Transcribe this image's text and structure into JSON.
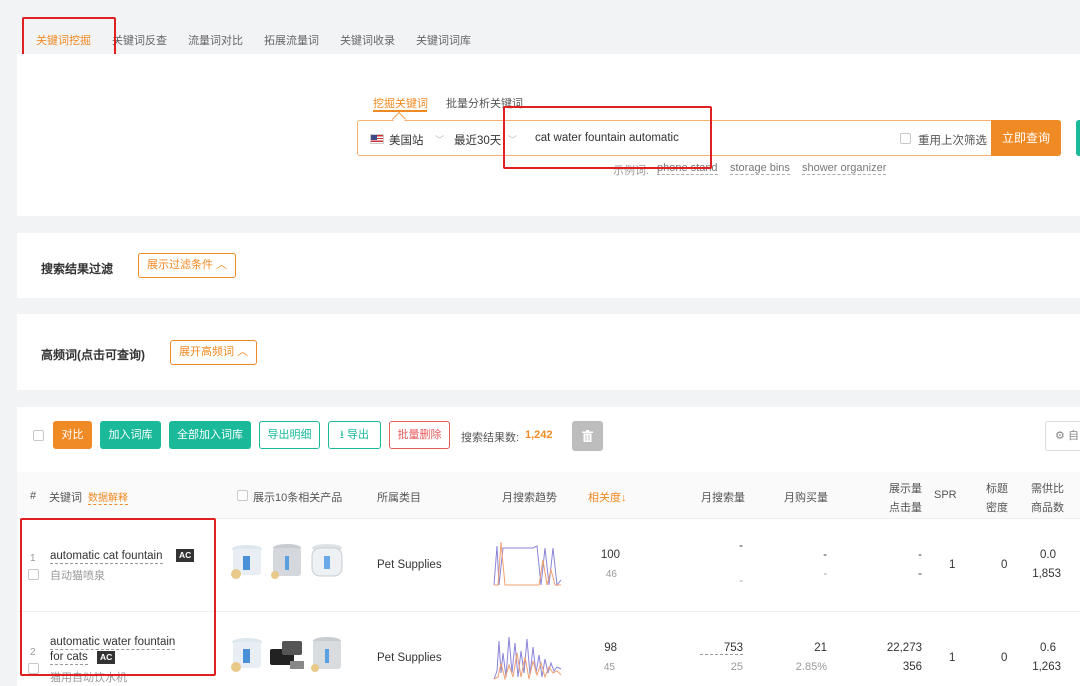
{
  "top_tabs": [
    "关键词挖掘",
    "关键词反查",
    "流量词对比",
    "拓展流量词",
    "关键词收录",
    "关键词词库"
  ],
  "search": {
    "subtabs": [
      "挖掘关键词",
      "批量分析关键词"
    ],
    "site": "美国站",
    "period": "最近30天",
    "query": "cat water fountain automatic",
    "reuse_label": "重用上次筛选",
    "submit_label": "立即查询",
    "examples_label": "示例词:",
    "examples": [
      "phone stand",
      "storage bins",
      "shower organizer"
    ]
  },
  "filter": {
    "title": "搜索结果过滤",
    "toggle": "展示过滤条件"
  },
  "frequent": {
    "title": "高频词(点击可查询)",
    "toggle": "展开高频词"
  },
  "toolbar": {
    "compare": "对比",
    "add_lib": "加入词库",
    "add_all": "全部加入词库",
    "export_detail": "导出明细",
    "export": "导出",
    "batch_delete": "批量删除",
    "count_label": "搜索结果数:",
    "count": "1,242",
    "settings_partial": "自"
  },
  "table": {
    "headers": {
      "index": "#",
      "keyword": "关键词",
      "data_explain": "数据解释",
      "show_products": "展示10条相关产品",
      "category": "所属类目",
      "trend": "月搜索趋势",
      "relevance": "相关度",
      "monthly_search": "月搜索量",
      "monthly_purchase": "月购买量",
      "impressions_1": "展示量",
      "impressions_2": "点击量",
      "spr": "SPR",
      "title_density_1": "标题",
      "title_density_2": "密度",
      "supply_demand_1": "需供比",
      "supply_demand_2": "商品数"
    },
    "rows": [
      {
        "index": "1",
        "keyword": "automatic cat fountain",
        "keyword_line2": "",
        "badge": "AC",
        "translation": "自动猫喷泉",
        "category": "Pet Supplies",
        "relevance": "100",
        "relevance_sub": "46",
        "monthly_search": "-",
        "monthly_search_sub": "-",
        "monthly_purchase": "-",
        "monthly_purchase_sub": "-",
        "impressions": "-",
        "clicks": "-",
        "spr": "1",
        "title_density": "0",
        "supply_demand": "0.0",
        "products": "1,853"
      },
      {
        "index": "2",
        "keyword": "automatic water fountain",
        "keyword_line2": "for cats",
        "badge": "AC",
        "translation": "猫用自动饮水机",
        "category": "Pet Supplies",
        "relevance": "98",
        "relevance_sub": "45",
        "monthly_search": "753",
        "monthly_search_sub": "25",
        "monthly_purchase": "21",
        "monthly_purchase_sub": "2.85%",
        "impressions": "22,273",
        "clicks": "356",
        "spr": "1",
        "title_density": "0",
        "supply_demand": "0.6",
        "products": "1,263"
      }
    ]
  },
  "colors": {
    "accent": "#f08a24",
    "teal": "#19b99a",
    "highlight_red": "#e02020"
  }
}
